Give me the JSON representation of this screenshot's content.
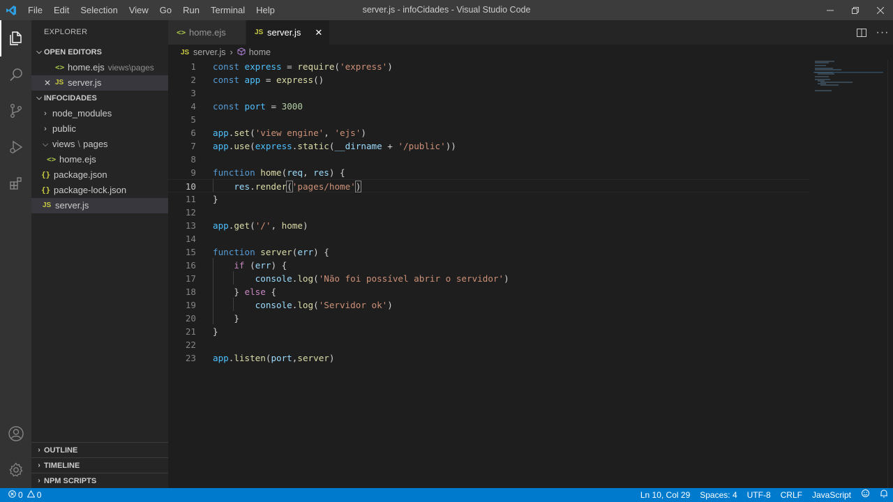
{
  "window": {
    "title": "server.js - infoCidades - Visual Studio Code",
    "menu": [
      "File",
      "Edit",
      "Selection",
      "View",
      "Go",
      "Run",
      "Terminal",
      "Help"
    ]
  },
  "sidebar": {
    "title": "EXPLORER",
    "open_editors": {
      "label": "OPEN EDITORS",
      "items": [
        {
          "name": "home.ejs",
          "desc": "views\\pages",
          "icon": "<>"
        },
        {
          "name": "server.js",
          "desc": "",
          "icon": "JS"
        }
      ]
    },
    "project": {
      "label": "INFOCIDADES",
      "items": [
        {
          "name": "node_modules",
          "kind": "folder"
        },
        {
          "name": "public",
          "kind": "folder"
        },
        {
          "name": "views",
          "sep": "\\",
          "sub": "pages",
          "kind": "folder-open"
        },
        {
          "name": "home.ejs",
          "kind": "ejs"
        },
        {
          "name": "package.json",
          "kind": "json"
        },
        {
          "name": "package-lock.json",
          "kind": "json"
        },
        {
          "name": "server.js",
          "kind": "js"
        }
      ]
    },
    "bottom": [
      "OUTLINE",
      "TIMELINE",
      "NPM SCRIPTS"
    ]
  },
  "tabs": [
    {
      "label": "home.ejs",
      "icon": "<>"
    },
    {
      "label": "server.js",
      "icon": "JS",
      "close": "✕"
    }
  ],
  "breadcrumb": {
    "file": "server.js",
    "file_icon": "JS",
    "symbol": "home"
  },
  "editor": {
    "lines": [
      "1",
      "2",
      "3",
      "4",
      "5",
      "6",
      "7",
      "8",
      "9",
      "10",
      "11",
      "12",
      "13",
      "14",
      "15",
      "16",
      "17",
      "18",
      "19",
      "20",
      "21",
      "22",
      "23"
    ]
  },
  "statusbar": {
    "errors": "0",
    "warnings": "0",
    "position": "Ln 10, Col 29",
    "spaces": "Spaces: 4",
    "encoding": "UTF-8",
    "eol": "CRLF",
    "language": "JavaScript"
  },
  "colors": {
    "statusbar": "#007acc",
    "keyword": "#569cd6",
    "string": "#ce9178",
    "function": "#dcdcaa",
    "variable": "#9cdcfe"
  }
}
